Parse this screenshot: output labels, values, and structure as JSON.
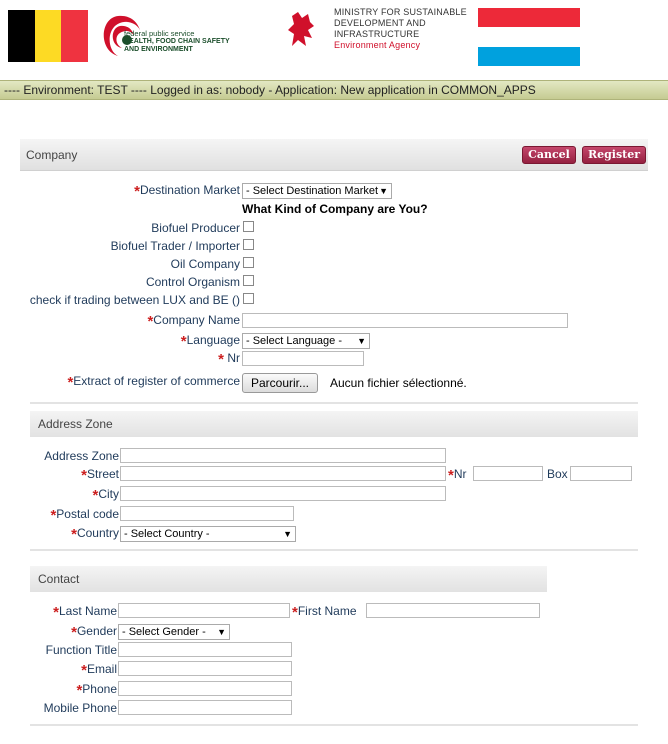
{
  "header": {
    "fps_line1": "federal public service",
    "fps_line2": "HEALTH, FOOD CHAIN SAFETY",
    "fps_line3": "AND ENVIRONMENT",
    "ministry_line1": "MINISTRY FOR SUSTAINABLE",
    "ministry_line2": "DEVELOPMENT AND",
    "ministry_line3": "INFRASTRUCTURE",
    "ministry_agency": "Environment Agency",
    "colors": {
      "be_black": "#000000",
      "be_yellow": "#fdda24",
      "be_red": "#ef3340",
      "lu_red": "#ed2939",
      "lu_white": "#ffffff",
      "lu_blue": "#00a1de"
    }
  },
  "env_bar": "---- Environment: TEST ---- Logged in as: nobody - Application: New application in COMMON_APPS",
  "company": {
    "title": "Company",
    "cancel_label": "Cancel",
    "register_label": "Register",
    "destination_market_label": "Destination Market",
    "destination_market_value": "- Select Destination Market -",
    "company_kind_heading": "What Kind of Company are You?",
    "biofuel_producer_label": "Biofuel Producer",
    "biofuel_trader_label": "Biofuel Trader / Importer",
    "oil_company_label": "Oil Company",
    "control_organism_label": "Control Organism",
    "trading_lux_be_label": "check if trading between LUX and BE ()",
    "company_name_label": "Company Name",
    "language_label": "Language",
    "language_value": "- Select Language -",
    "nr_label": "Nr",
    "extract_label": "Extract of register of commerce",
    "browse_label": "Parcourir...",
    "no_file_text": "Aucun fichier sélectionné."
  },
  "address": {
    "title": "Address Zone",
    "address_zone_label": "Address Zone",
    "street_label": "Street",
    "nr_label": "Nr",
    "box_label": "Box",
    "city_label": "City",
    "postal_code_label": "Postal code",
    "country_label": "Country",
    "country_value": "- Select Country -"
  },
  "contact": {
    "title": "Contact",
    "last_name_label": "Last Name",
    "first_name_label": "First Name",
    "gender_label": "Gender",
    "gender_value": "- Select Gender -",
    "function_title_label": "Function Title",
    "email_label": "Email",
    "phone_label": "Phone",
    "mobile_phone_label": "Mobile Phone"
  }
}
